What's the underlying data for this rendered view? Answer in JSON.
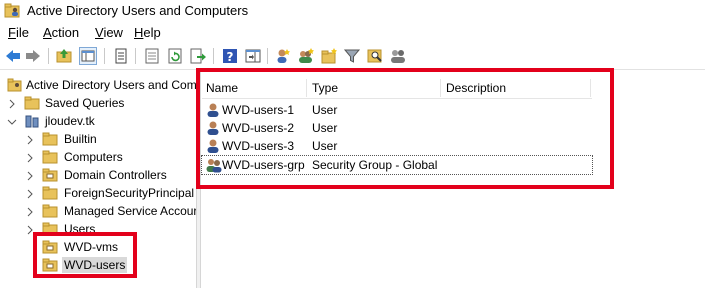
{
  "window": {
    "title": "Active Directory Users and Computers"
  },
  "menu": {
    "file": {
      "accel": "F",
      "rest": "ile"
    },
    "action": {
      "accel": "A",
      "rest": "ction"
    },
    "view": {
      "accel": "V",
      "rest": "iew"
    },
    "help": {
      "accel": "H",
      "rest": "elp"
    }
  },
  "toolbar": {
    "buttons": [
      "back-icon",
      "forward-icon",
      "up-folder-icon",
      "show-hide-tree-icon",
      "copy-icon",
      "properties-icon",
      "refresh-icon",
      "export-list-icon",
      "help-icon",
      "action-pane-icon",
      "new-user-icon",
      "new-group-icon",
      "new-ou-icon",
      "filter-icon",
      "find-icon",
      "add-to-group-icon"
    ]
  },
  "tree": {
    "root": "Active Directory Users and Com",
    "saved_queries": "Saved Queries",
    "domain": "jloudev.tk",
    "children": [
      "Builtin",
      "Computers",
      "Domain Controllers",
      "ForeignSecurityPrincipal",
      "Managed Service Accour",
      "Users",
      "WVD-vms",
      "WVD-users"
    ]
  },
  "list": {
    "columns": [
      "Name",
      "Type",
      "Description"
    ],
    "rows": [
      {
        "name": "WVD-users-1",
        "type": "User",
        "kind": "user"
      },
      {
        "name": "WVD-users-2",
        "type": "User",
        "kind": "user"
      },
      {
        "name": "WVD-users-3",
        "type": "User",
        "kind": "user"
      },
      {
        "name": "WVD-users-grp",
        "type": "Security Group - Global",
        "kind": "group"
      }
    ]
  },
  "colors": {
    "highlight": "#e3001b",
    "folder": "#e8c25b"
  }
}
